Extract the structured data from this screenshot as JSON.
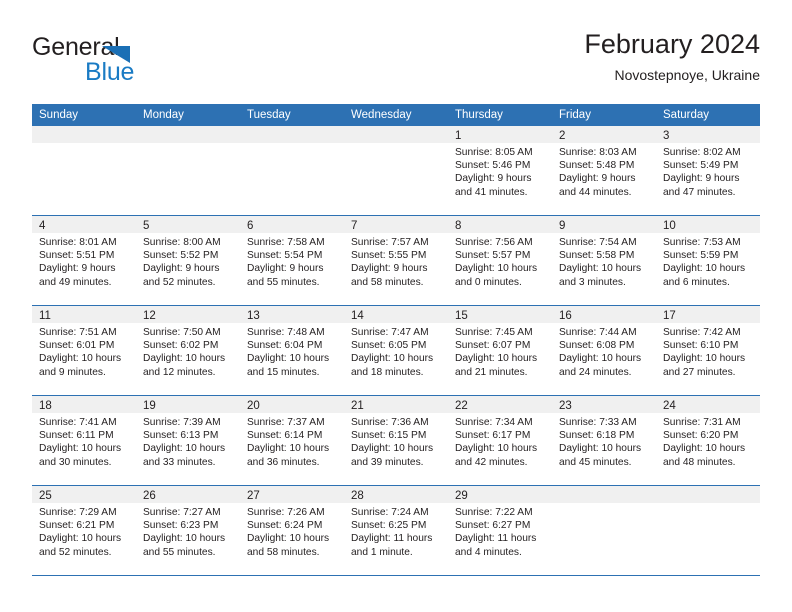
{
  "brand": {
    "name_top": "General",
    "name_bottom": "Blue",
    "triangle_icon": "triangle-icon",
    "colors": {
      "general": "#231f20",
      "blue": "#1a7bc4",
      "triangle": "#1a6fb5"
    }
  },
  "header": {
    "title": "February 2024",
    "subtitle": "Novostepnoye, Ukraine"
  },
  "theme": {
    "header_blue": "#2d71b3",
    "daynum_band_gray": "#f0f0f0",
    "text": "#231f20",
    "cell_background": "#ffffff"
  },
  "calendar": {
    "weekdays": [
      "Sunday",
      "Monday",
      "Tuesday",
      "Wednesday",
      "Thursday",
      "Friday",
      "Saturday"
    ],
    "weeks": [
      [
        {
          "day": "",
          "lines": []
        },
        {
          "day": "",
          "lines": []
        },
        {
          "day": "",
          "lines": []
        },
        {
          "day": "",
          "lines": []
        },
        {
          "day": "1",
          "lines": [
            "Sunrise: 8:05 AM",
            "Sunset: 5:46 PM",
            "Daylight: 9 hours",
            "and 41 minutes."
          ]
        },
        {
          "day": "2",
          "lines": [
            "Sunrise: 8:03 AM",
            "Sunset: 5:48 PM",
            "Daylight: 9 hours",
            "and 44 minutes."
          ]
        },
        {
          "day": "3",
          "lines": [
            "Sunrise: 8:02 AM",
            "Sunset: 5:49 PM",
            "Daylight: 9 hours",
            "and 47 minutes."
          ]
        }
      ],
      [
        {
          "day": "4",
          "lines": [
            "Sunrise: 8:01 AM",
            "Sunset: 5:51 PM",
            "Daylight: 9 hours",
            "and 49 minutes."
          ]
        },
        {
          "day": "5",
          "lines": [
            "Sunrise: 8:00 AM",
            "Sunset: 5:52 PM",
            "Daylight: 9 hours",
            "and 52 minutes."
          ]
        },
        {
          "day": "6",
          "lines": [
            "Sunrise: 7:58 AM",
            "Sunset: 5:54 PM",
            "Daylight: 9 hours",
            "and 55 minutes."
          ]
        },
        {
          "day": "7",
          "lines": [
            "Sunrise: 7:57 AM",
            "Sunset: 5:55 PM",
            "Daylight: 9 hours",
            "and 58 minutes."
          ]
        },
        {
          "day": "8",
          "lines": [
            "Sunrise: 7:56 AM",
            "Sunset: 5:57 PM",
            "Daylight: 10 hours",
            "and 0 minutes."
          ]
        },
        {
          "day": "9",
          "lines": [
            "Sunrise: 7:54 AM",
            "Sunset: 5:58 PM",
            "Daylight: 10 hours",
            "and 3 minutes."
          ]
        },
        {
          "day": "10",
          "lines": [
            "Sunrise: 7:53 AM",
            "Sunset: 5:59 PM",
            "Daylight: 10 hours",
            "and 6 minutes."
          ]
        }
      ],
      [
        {
          "day": "11",
          "lines": [
            "Sunrise: 7:51 AM",
            "Sunset: 6:01 PM",
            "Daylight: 10 hours",
            "and 9 minutes."
          ]
        },
        {
          "day": "12",
          "lines": [
            "Sunrise: 7:50 AM",
            "Sunset: 6:02 PM",
            "Daylight: 10 hours",
            "and 12 minutes."
          ]
        },
        {
          "day": "13",
          "lines": [
            "Sunrise: 7:48 AM",
            "Sunset: 6:04 PM",
            "Daylight: 10 hours",
            "and 15 minutes."
          ]
        },
        {
          "day": "14",
          "lines": [
            "Sunrise: 7:47 AM",
            "Sunset: 6:05 PM",
            "Daylight: 10 hours",
            "and 18 minutes."
          ]
        },
        {
          "day": "15",
          "lines": [
            "Sunrise: 7:45 AM",
            "Sunset: 6:07 PM",
            "Daylight: 10 hours",
            "and 21 minutes."
          ]
        },
        {
          "day": "16",
          "lines": [
            "Sunrise: 7:44 AM",
            "Sunset: 6:08 PM",
            "Daylight: 10 hours",
            "and 24 minutes."
          ]
        },
        {
          "day": "17",
          "lines": [
            "Sunrise: 7:42 AM",
            "Sunset: 6:10 PM",
            "Daylight: 10 hours",
            "and 27 minutes."
          ]
        }
      ],
      [
        {
          "day": "18",
          "lines": [
            "Sunrise: 7:41 AM",
            "Sunset: 6:11 PM",
            "Daylight: 10 hours",
            "and 30 minutes."
          ]
        },
        {
          "day": "19",
          "lines": [
            "Sunrise: 7:39 AM",
            "Sunset: 6:13 PM",
            "Daylight: 10 hours",
            "and 33 minutes."
          ]
        },
        {
          "day": "20",
          "lines": [
            "Sunrise: 7:37 AM",
            "Sunset: 6:14 PM",
            "Daylight: 10 hours",
            "and 36 minutes."
          ]
        },
        {
          "day": "21",
          "lines": [
            "Sunrise: 7:36 AM",
            "Sunset: 6:15 PM",
            "Daylight: 10 hours",
            "and 39 minutes."
          ]
        },
        {
          "day": "22",
          "lines": [
            "Sunrise: 7:34 AM",
            "Sunset: 6:17 PM",
            "Daylight: 10 hours",
            "and 42 minutes."
          ]
        },
        {
          "day": "23",
          "lines": [
            "Sunrise: 7:33 AM",
            "Sunset: 6:18 PM",
            "Daylight: 10 hours",
            "and 45 minutes."
          ]
        },
        {
          "day": "24",
          "lines": [
            "Sunrise: 7:31 AM",
            "Sunset: 6:20 PM",
            "Daylight: 10 hours",
            "and 48 minutes."
          ]
        }
      ],
      [
        {
          "day": "25",
          "lines": [
            "Sunrise: 7:29 AM",
            "Sunset: 6:21 PM",
            "Daylight: 10 hours",
            "and 52 minutes."
          ]
        },
        {
          "day": "26",
          "lines": [
            "Sunrise: 7:27 AM",
            "Sunset: 6:23 PM",
            "Daylight: 10 hours",
            "and 55 minutes."
          ]
        },
        {
          "day": "27",
          "lines": [
            "Sunrise: 7:26 AM",
            "Sunset: 6:24 PM",
            "Daylight: 10 hours",
            "and 58 minutes."
          ]
        },
        {
          "day": "28",
          "lines": [
            "Sunrise: 7:24 AM",
            "Sunset: 6:25 PM",
            "Daylight: 11 hours",
            "and 1 minute."
          ]
        },
        {
          "day": "29",
          "lines": [
            "Sunrise: 7:22 AM",
            "Sunset: 6:27 PM",
            "Daylight: 11 hours",
            "and 4 minutes."
          ]
        },
        {
          "day": "",
          "lines": []
        },
        {
          "day": "",
          "lines": []
        }
      ]
    ]
  }
}
